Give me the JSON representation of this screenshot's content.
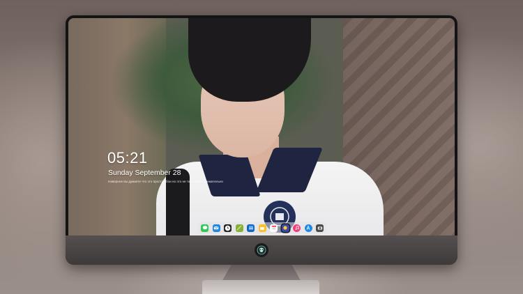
{
  "lock_screen": {
    "time": "05:21",
    "date": "Sunday September  28",
    "quote": "Наверное вы думаете что это просто обои но это не так смотри внимательно"
  },
  "dock": {
    "items": [
      {
        "icon": "messages-icon",
        "color": "#34c759"
      },
      {
        "icon": "mail-icon",
        "color": "#1e88e5"
      },
      {
        "icon": "clock-icon",
        "color": "#222222"
      },
      {
        "icon": "maps-icon",
        "color": "#7cb342"
      },
      {
        "icon": "videos-icon",
        "color": "#1565c0"
      },
      {
        "icon": "notes-icon",
        "color": "#fbc02d"
      },
      {
        "icon": "calendar-icon",
        "color": "#ffffff"
      },
      {
        "icon": "photos-icon",
        "color": "#3949ab"
      },
      {
        "icon": "itunes-icon",
        "color": "#ec407a"
      },
      {
        "icon": "app-store-icon",
        "color": "#1e88e5"
      },
      {
        "icon": "camera-icon",
        "color": "#4a4a4a"
      }
    ]
  }
}
